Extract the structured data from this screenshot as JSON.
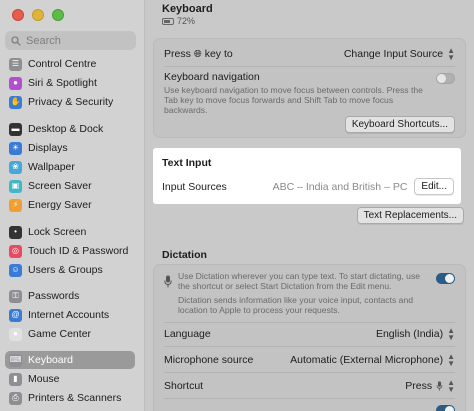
{
  "window": {
    "title": "Keyboard",
    "battery": "72%"
  },
  "search": {
    "placeholder": "Search"
  },
  "sidebar": {
    "items": [
      {
        "label": "Control Centre",
        "icon": "control-centre-icon",
        "color": "#8e8e93"
      },
      {
        "label": "Siri & Spotlight",
        "icon": "siri-icon",
        "color": "#b04fd0"
      },
      {
        "label": "Privacy & Security",
        "icon": "hand-icon",
        "color": "#3a7bd5"
      },
      {
        "label": "Desktop & Dock",
        "icon": "dock-icon",
        "color": "#333333"
      },
      {
        "label": "Displays",
        "icon": "display-icon",
        "color": "#3a7bd5"
      },
      {
        "label": "Wallpaper",
        "icon": "wallpaper-icon",
        "color": "#45a8d8"
      },
      {
        "label": "Screen Saver",
        "icon": "screen-saver-icon",
        "color": "#41b8c8"
      },
      {
        "label": "Energy Saver",
        "icon": "battery-icon",
        "color": "#f0a030"
      },
      {
        "label": "Lock Screen",
        "icon": "lock-icon",
        "color": "#333333"
      },
      {
        "label": "Touch ID & Password",
        "icon": "fingerprint-icon",
        "color": "#e84a5f"
      },
      {
        "label": "Users & Groups",
        "icon": "users-icon",
        "color": "#3a7bd5"
      },
      {
        "label": "Passwords",
        "icon": "key-icon",
        "color": "#8e8e93"
      },
      {
        "label": "Internet Accounts",
        "icon": "at-icon",
        "color": "#3a7bd5"
      },
      {
        "label": "Game Center",
        "icon": "game-center-icon",
        "color": "#e0e0e0"
      },
      {
        "label": "Keyboard",
        "icon": "keyboard-icon",
        "color": "#8e8e93",
        "selected": true
      },
      {
        "label": "Mouse",
        "icon": "mouse-icon",
        "color": "#8e8e93"
      },
      {
        "label": "Printers & Scanners",
        "icon": "printer-icon",
        "color": "#8e8e93"
      }
    ]
  },
  "settings": {
    "press_key": {
      "label_before": "Press",
      "label_after": "key to",
      "value": "Change Input Source"
    },
    "keyboard_navigation": {
      "label": "Keyboard navigation",
      "description": "Use keyboard navigation to move focus between controls. Press the Tab key to move focus forwards and Shift Tab to move focus backwards.",
      "enabled": false
    },
    "keyboard_shortcuts_button": "Keyboard Shortcuts...",
    "text_input": {
      "title": "Text Input",
      "input_sources_label": "Input Sources",
      "input_sources_value": "ABC – India and British – PC",
      "edit_button": "Edit..."
    },
    "text_replacements_button": "Text Replacements...",
    "dictation": {
      "title": "Dictation",
      "description": "Use Dictation wherever you can type text. To start dictating, use the shortcut or select Start Dictation from the Edit menu.",
      "info": "Dictation sends information like your voice input, contacts and location to Apple to process your requests.",
      "enabled": true,
      "language_label": "Language",
      "language_value": "English (India)",
      "mic_label": "Microphone source",
      "mic_value": "Automatic (External Microphone)",
      "shortcut_label": "Shortcut",
      "shortcut_value": "Press"
    }
  }
}
